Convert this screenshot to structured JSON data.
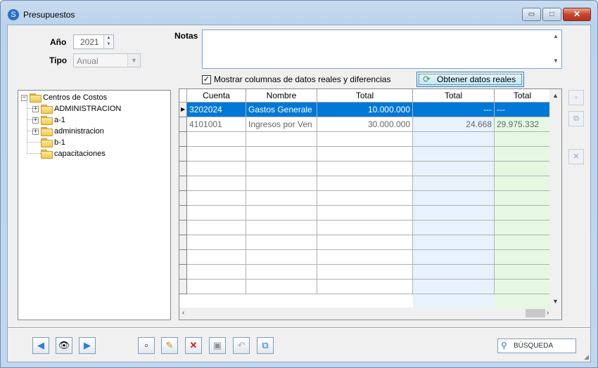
{
  "window": {
    "title": "Presupuestos",
    "minimize": "▭",
    "maximize": "□",
    "close": "✕"
  },
  "form": {
    "year_label": "Año",
    "year_value": "2021",
    "type_label": "Tipo",
    "type_value": "Anual",
    "notes_label": "Notas",
    "notes_value": "",
    "show_real_label": "Mostrar columnas de datos reales y diferencias",
    "show_real_checked": true,
    "obtain_button": "Obtener datos reales"
  },
  "tree": {
    "root": "Centros de Costos",
    "items": [
      "ADMINISTRACION",
      "a-1",
      "administracion",
      "b-1",
      "capacitaciones"
    ]
  },
  "grid": {
    "columns": [
      "Cuenta",
      "Nombre",
      "Total",
      "Total",
      "Total"
    ],
    "rows": [
      [
        "3202024",
        "Gastos Generale",
        "10.000.000",
        "---",
        "---"
      ],
      [
        "4101001",
        "Ingresos por Ven",
        "30.000.000",
        "24.668",
        "29.975.332"
      ]
    ],
    "selected_row": 0
  },
  "search": {
    "label": "BÚSQUEDA"
  },
  "colors": {
    "selection": "#0078d7",
    "real_col": "#e8f2fc",
    "diff_col": "#e6f8e2"
  }
}
